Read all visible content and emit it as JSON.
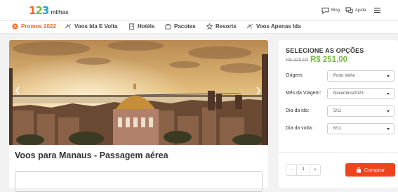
{
  "brand": {
    "digits": [
      "1",
      "2",
      "3"
    ],
    "word": "milhas",
    "colors": {
      "orange": "#f26722",
      "green": "#7ab648",
      "blue": "#1ca1dc"
    }
  },
  "header": {
    "blog_label": "Blog",
    "help_label": "Ajuda",
    "icons": {
      "blog": "chat-bubble-icon",
      "help": "chat-bubbles-icon",
      "menu": "hamburger-menu-icon"
    }
  },
  "nav": {
    "items": [
      {
        "label": "Promos 2022",
        "icon": "promo-tag-icon",
        "active": true
      },
      {
        "label": "Voos Ida E Volta",
        "icon": "airplane-icon",
        "active": false
      },
      {
        "label": "Hotéis",
        "icon": "hotel-building-icon",
        "active": false
      },
      {
        "label": "Pacotes",
        "icon": "suitcase-icon",
        "active": false
      },
      {
        "label": "Resorts",
        "icon": "star-icon",
        "active": false
      },
      {
        "label": "Voos Apenas Ida",
        "icon": "airplane-icon",
        "active": false
      }
    ]
  },
  "main": {
    "hero_alt": "manaus-city-skyline-photo",
    "title": "Voos para Manaus - Passagem aérea"
  },
  "panel": {
    "title": "SELECIONE AS OPÇÕES",
    "old_price": "R$ 325,00",
    "new_price": "R$ 251,00",
    "fields": [
      {
        "label": "Origem:",
        "value": "Porto Velho"
      },
      {
        "label": "Mês da Viagem:",
        "value": "Novembro/2023"
      },
      {
        "label": "Dia da ida:",
        "value": "5/11"
      },
      {
        "label": "Dia da volta:",
        "value": "6/11"
      }
    ],
    "quantity": "1",
    "decrement": "-",
    "increment": "+",
    "buy_label": "Comprar",
    "accent_color": "#f0441c",
    "price_color": "#7ab648"
  }
}
